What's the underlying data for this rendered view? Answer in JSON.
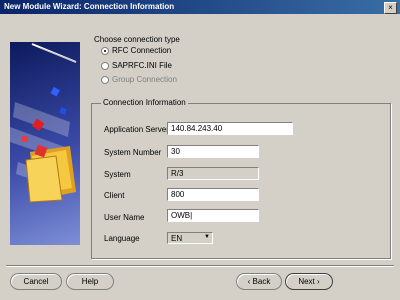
{
  "window": {
    "title": "New Module Wizard: Connection Information",
    "close_glyph": "×"
  },
  "connection_type": {
    "heading": "Choose connection type",
    "options": [
      {
        "label": "RFC Connection",
        "selected": true,
        "enabled": true
      },
      {
        "label": "SAPRFC.INI File",
        "selected": false,
        "enabled": true
      },
      {
        "label": "Group Connection",
        "selected": false,
        "enabled": false
      }
    ]
  },
  "connection_info": {
    "title": "Connection Information",
    "fields": {
      "application_server": {
        "label": "Application Server",
        "value": "140.84.243.40"
      },
      "system_number": {
        "label": "System Number",
        "value": "30"
      },
      "system": {
        "label": "System",
        "value": "R/3"
      },
      "client": {
        "label": "Client",
        "value": "800"
      },
      "user_name": {
        "label": "User Name",
        "value": "OWB"
      },
      "language": {
        "label": "Language",
        "value": "EN"
      }
    }
  },
  "buttons": {
    "cancel": "Cancel",
    "help": "Help",
    "back": "Back",
    "next": "Next"
  },
  "icons": {
    "back": "chevron-left-icon",
    "next": "chevron-right-icon"
  },
  "colors": {
    "titlebar": "#0a246a",
    "background": "#d4d0c8"
  }
}
